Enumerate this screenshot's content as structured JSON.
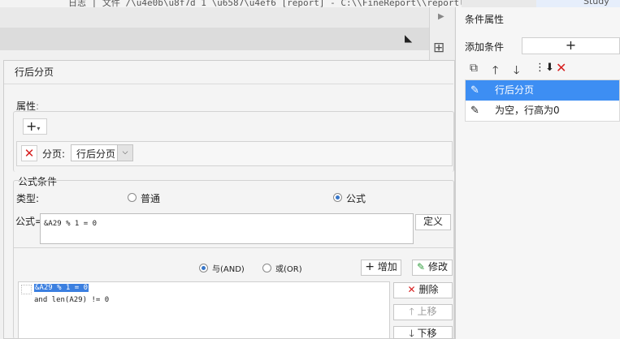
{
  "window": {
    "title_fragment": "日志 | 文件 /\\u4e0b\\u8f7d 1 \\u6587\\u4ef6 [report] - C:\\\\FineReport\\\\reportlets\\\\report.cpt",
    "right_cut_text": "Study"
  },
  "right_panel": {
    "title": "条件属性",
    "add_label": "添加条件",
    "add_button": "+",
    "tools": [
      "copy-icon",
      "arrow-up-icon",
      "arrow-down-icon",
      "sort-icon",
      "delete-icon"
    ],
    "items": [
      {
        "label": "行后分页",
        "selected": true
      },
      {
        "label": "为空，行高为0",
        "selected": false
      }
    ]
  },
  "dialog": {
    "title": "行后分页",
    "attr_section_label": "属性",
    "attr_colon": ":",
    "plus_button": "+",
    "plus_caret": "▾",
    "page_label": "分页:",
    "page_select_value": "行后分页",
    "formula_section_label": "公式条件",
    "type_label": "类型:",
    "type_options": [
      {
        "label": "普通",
        "checked": false
      },
      {
        "label": "公式",
        "checked": true
      }
    ],
    "formula_label": "公式=",
    "formula_value": "&A29 % 1 = 0",
    "define_button": "定义",
    "logic_options": [
      {
        "label": "与(AND)",
        "checked": true
      },
      {
        "label": "或(OR)",
        "checked": false
      }
    ],
    "add_button": "增加",
    "modify_button": "修改",
    "delete_button": "删除",
    "move_up_button": "上移",
    "move_down_button": "下移",
    "expressions": [
      "&A29 % 1 = 0",
      "and len(A29) != 0"
    ]
  },
  "colors": {
    "selected": "#3d8ef3",
    "danger": "#d61f1f",
    "accent_green": "#2e9c3b"
  }
}
